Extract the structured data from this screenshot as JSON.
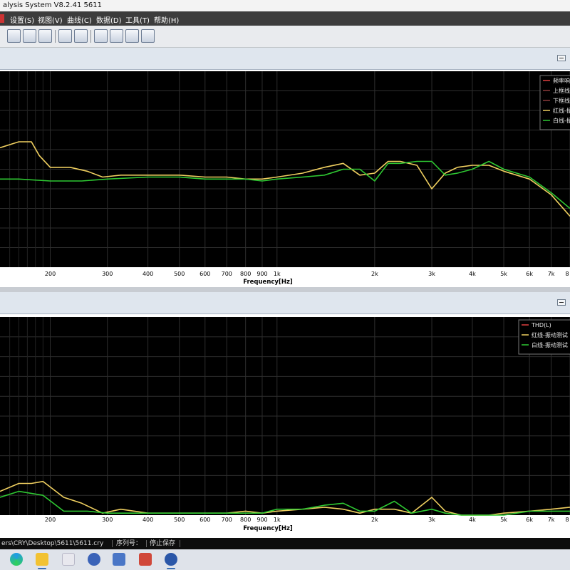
{
  "window": {
    "title": "alysis System  V8.2.41 5611"
  },
  "menu": [
    "设置(S)",
    "视图(V)",
    "曲线(C)",
    "数据(D)",
    "工具(T)",
    "帮助(H)"
  ],
  "toolbar": {
    "buttons": [
      "setup-icon",
      "curve-settings-icon",
      "open-file-icon",
      "folder-open-icon",
      "save-icon",
      "new-window-icon",
      "add-chart-icon",
      "horizontal-layout-icon",
      "vertical-layout-icon"
    ]
  },
  "colors": {
    "plot_bg": "#000000",
    "grid": "#2e2e2e",
    "yellow": "#f0d060",
    "green": "#2ec832",
    "red": "#e04040",
    "label": "#000000"
  },
  "chart_data": [
    {
      "type": "line",
      "title": "",
      "xlabel": "Frequency[Hz]",
      "ylabel": "",
      "x_scale": "log",
      "xlim": [
        140,
        8000
      ],
      "ylim": [
        0,
        100
      ],
      "grid": true,
      "legend_position": "top-right",
      "x_ticks": [
        {
          "v": 200,
          "label": "200"
        },
        {
          "v": 300,
          "label": "300"
        },
        {
          "v": 400,
          "label": "400"
        },
        {
          "v": 500,
          "label": "500"
        },
        {
          "v": 600,
          "label": "600"
        },
        {
          "v": 700,
          "label": "700"
        },
        {
          "v": 800,
          "label": "800"
        },
        {
          "v": 900,
          "label": "900"
        },
        {
          "v": 1000,
          "label": "1k"
        },
        {
          "v": 2000,
          "label": "2k"
        },
        {
          "v": 3000,
          "label": "3k"
        },
        {
          "v": 4000,
          "label": "4k"
        },
        {
          "v": 5000,
          "label": "5k"
        },
        {
          "v": 6000,
          "label": "6k"
        },
        {
          "v": 7000,
          "label": "7k"
        },
        {
          "v": 8000,
          "label": "8"
        }
      ],
      "legend": [
        {
          "label": "频率响",
          "color": "#e04040"
        },
        {
          "label": "上框线",
          "color": "#8a3a3a"
        },
        {
          "label": "下框线",
          "color": "#8a3a3a"
        },
        {
          "label": "红线-振",
          "color": "#f0d060"
        },
        {
          "label": "白线-振",
          "color": "#2ec832"
        }
      ],
      "series": [
        {
          "color": "#f0d060",
          "x": [
            140,
            160,
            175,
            185,
            200,
            230,
            260,
            290,
            330,
            400,
            500,
            600,
            700,
            800,
            900,
            1000,
            1200,
            1400,
            1600,
            1800,
            2000,
            2200,
            2400,
            2700,
            3000,
            3300,
            3600,
            4000,
            4500,
            5000,
            6000,
            7000,
            8000
          ],
          "y": [
            61,
            64,
            64,
            57,
            51,
            51,
            49,
            46,
            47,
            47,
            47,
            46,
            46,
            45,
            45,
            46,
            48,
            51,
            53,
            47,
            48,
            54,
            54,
            52,
            40,
            48,
            51,
            52,
            52,
            49,
            45,
            37,
            26
          ]
        },
        {
          "color": "#2ec832",
          "x": [
            140,
            160,
            200,
            250,
            300,
            400,
            500,
            600,
            700,
            800,
            900,
            1000,
            1200,
            1400,
            1600,
            1800,
            2000,
            2200,
            2400,
            2700,
            3000,
            3300,
            3600,
            4000,
            4500,
            5000,
            6000,
            7000,
            8000
          ],
          "y": [
            45,
            45,
            44,
            44,
            45,
            46,
            46,
            45,
            45,
            45,
            44,
            45,
            46,
            47,
            50,
            50,
            44,
            53,
            53,
            54,
            54,
            47,
            48,
            50,
            54,
            50,
            46,
            38,
            30
          ]
        }
      ]
    },
    {
      "type": "line",
      "title": "",
      "xlabel": "Frequency[Hz]",
      "ylabel": "",
      "x_scale": "log",
      "xlim": [
        140,
        8000
      ],
      "ylim": [
        0,
        100
      ],
      "grid": true,
      "legend_position": "top-right",
      "x_ticks": [
        {
          "v": 200,
          "label": "200"
        },
        {
          "v": 300,
          "label": "300"
        },
        {
          "v": 400,
          "label": "400"
        },
        {
          "v": 500,
          "label": "500"
        },
        {
          "v": 600,
          "label": "600"
        },
        {
          "v": 700,
          "label": "700"
        },
        {
          "v": 800,
          "label": "800"
        },
        {
          "v": 900,
          "label": "900"
        },
        {
          "v": 1000,
          "label": "1k"
        },
        {
          "v": 2000,
          "label": "2k"
        },
        {
          "v": 3000,
          "label": "3k"
        },
        {
          "v": 4000,
          "label": "4k"
        },
        {
          "v": 5000,
          "label": "5k"
        },
        {
          "v": 6000,
          "label": "6k"
        },
        {
          "v": 7000,
          "label": "7k"
        },
        {
          "v": 8000,
          "label": "8"
        }
      ],
      "legend": [
        {
          "label": "THD(L)",
          "color": "#e04040"
        },
        {
          "label": "红线-振动测试",
          "color": "#f0d060"
        },
        {
          "label": "白线-振动测试",
          "color": "#2ec832"
        }
      ],
      "series": [
        {
          "color": "#f0d060",
          "x": [
            140,
            160,
            175,
            190,
            220,
            250,
            290,
            330,
            400,
            500,
            600,
            700,
            800,
            900,
            1000,
            1200,
            1400,
            1600,
            1800,
            2000,
            2300,
            2600,
            3000,
            3300,
            3700,
            4000,
            4500,
            5000,
            6000,
            7000,
            8000
          ],
          "y": [
            12,
            16,
            16,
            17,
            9,
            6,
            1,
            3,
            1,
            1,
            1,
            1,
            2,
            1,
            2,
            3,
            4,
            3,
            1,
            3,
            3,
            1,
            9,
            2,
            0,
            0,
            0,
            1,
            2,
            3,
            4
          ]
        },
        {
          "color": "#2ec832",
          "x": [
            140,
            160,
            190,
            220,
            260,
            300,
            400,
            500,
            600,
            700,
            800,
            900,
            1000,
            1200,
            1400,
            1600,
            1800,
            2000,
            2300,
            2600,
            3000,
            3300,
            3700,
            4000,
            4500,
            5000,
            6000,
            7000,
            8000
          ],
          "y": [
            9,
            12,
            10,
            2,
            2,
            1,
            1,
            1,
            1,
            1,
            1,
            1,
            3,
            3,
            5,
            6,
            2,
            2,
            7,
            1,
            3,
            1,
            0,
            0,
            0,
            0,
            2,
            2,
            2
          ]
        }
      ]
    }
  ],
  "status": {
    "path": "ers\\CRY\\Desktop\\5611\\5611.cry",
    "serial_label": "序列号：",
    "save_state": "停止保存"
  },
  "taskbar": {
    "icons": [
      "start-icon",
      "edge-icon",
      "file-explorer-icon",
      "app-icon",
      "car-app-icon",
      "building-app-icon",
      "analyzer-app-icon",
      "ford-app-icon"
    ]
  }
}
